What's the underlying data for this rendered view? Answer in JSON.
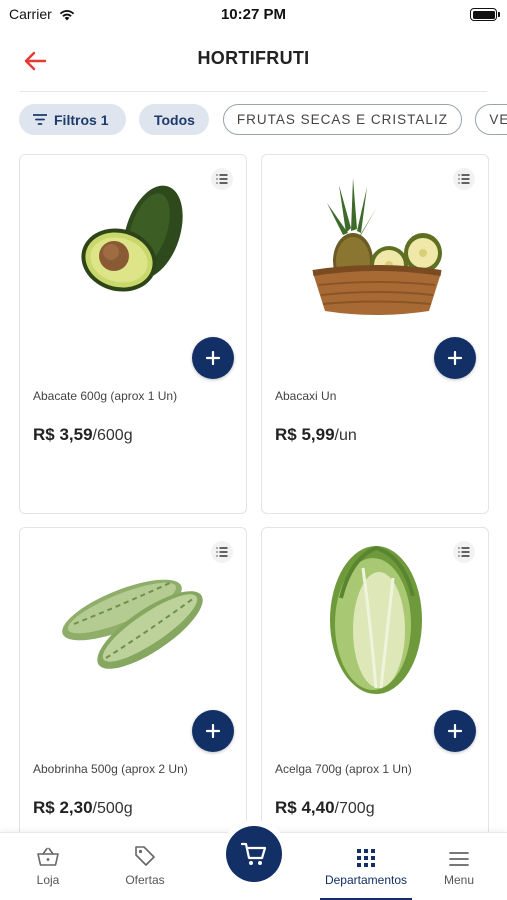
{
  "status_bar": {
    "carrier": "Carrier",
    "time": "10:27 PM"
  },
  "header": {
    "title": "HORTIFRUTI",
    "back_icon": "arrow-left-icon"
  },
  "colors": {
    "primary": "#123066",
    "accent_back": "#e53935",
    "chip_bg": "#dfe5ee"
  },
  "filters": {
    "filter_label": "Filtros",
    "filter_count": "1",
    "all_label": "Todos",
    "categories": [
      "FRUTAS SECAS E CRISTALIZ",
      "VERD"
    ]
  },
  "products": [
    {
      "name": "Abacate 600g (aprox 1 Un)",
      "price": "R$ 3,59",
      "unit": "/600g",
      "image": "avocado"
    },
    {
      "name": "Abacaxi Un",
      "price": "R$ 5,99",
      "unit": "/un",
      "image": "pineapple-basket"
    },
    {
      "name": "Abobrinha 500g (aprox 2 Un)",
      "price": "R$ 2,30",
      "unit": "/500g",
      "image": "zucchini"
    },
    {
      "name": "Acelga 700g (aprox 1 Un)",
      "price": "R$ 4,40",
      "unit": "/700g",
      "image": "chinese-cabbage"
    }
  ],
  "bottom_nav": {
    "items": [
      {
        "label": "Loja",
        "icon": "basket-icon"
      },
      {
        "label": "Ofertas",
        "icon": "tag-icon"
      },
      {
        "label": "Departamentos",
        "icon": "grid-icon",
        "active": true
      },
      {
        "label": "Menu",
        "icon": "menu-icon"
      }
    ],
    "cart_icon": "cart-icon"
  }
}
